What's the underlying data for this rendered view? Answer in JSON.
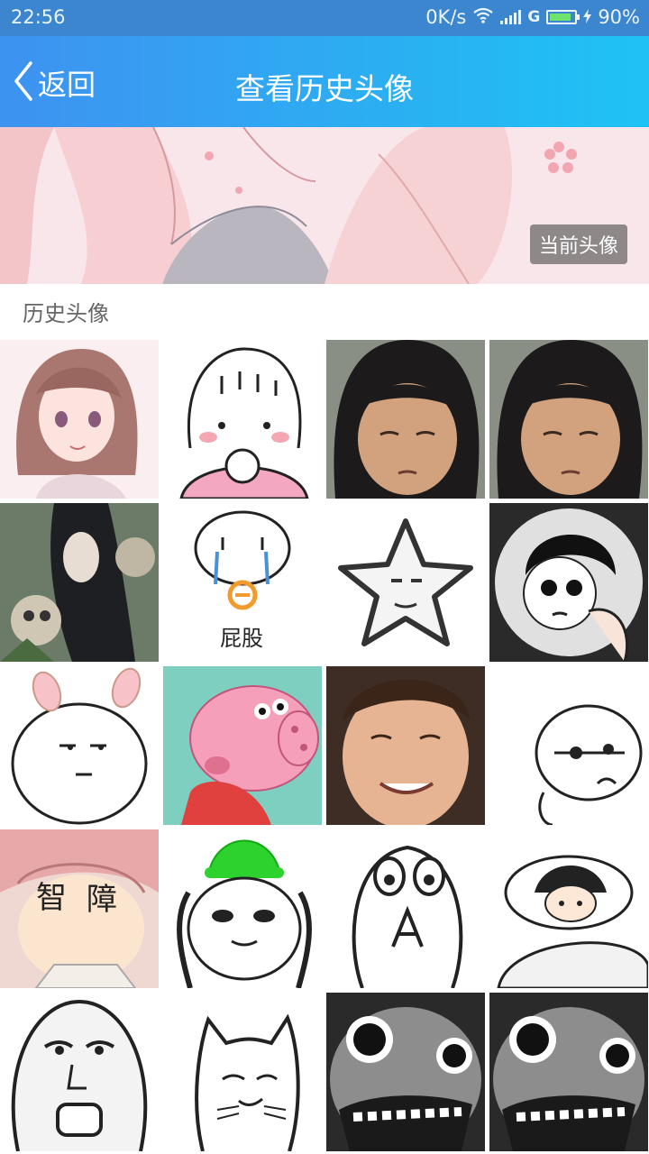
{
  "status_bar": {
    "time": "22:56",
    "net_speed": "0K/s",
    "network_type": "G",
    "battery": "90%",
    "battery_level": 0.9
  },
  "nav": {
    "back_label": "返回",
    "title": "查看历史头像"
  },
  "current_avatar": {
    "badge": "当前头像"
  },
  "history": {
    "label": "历史头像",
    "captions": {
      "butt": "屁股",
      "zhi": "智",
      "zhang": "障"
    }
  },
  "colors": {
    "status_bar": "#3c86cf",
    "nav_start": "#3e92f0",
    "nav_end": "#1ec3f4"
  }
}
